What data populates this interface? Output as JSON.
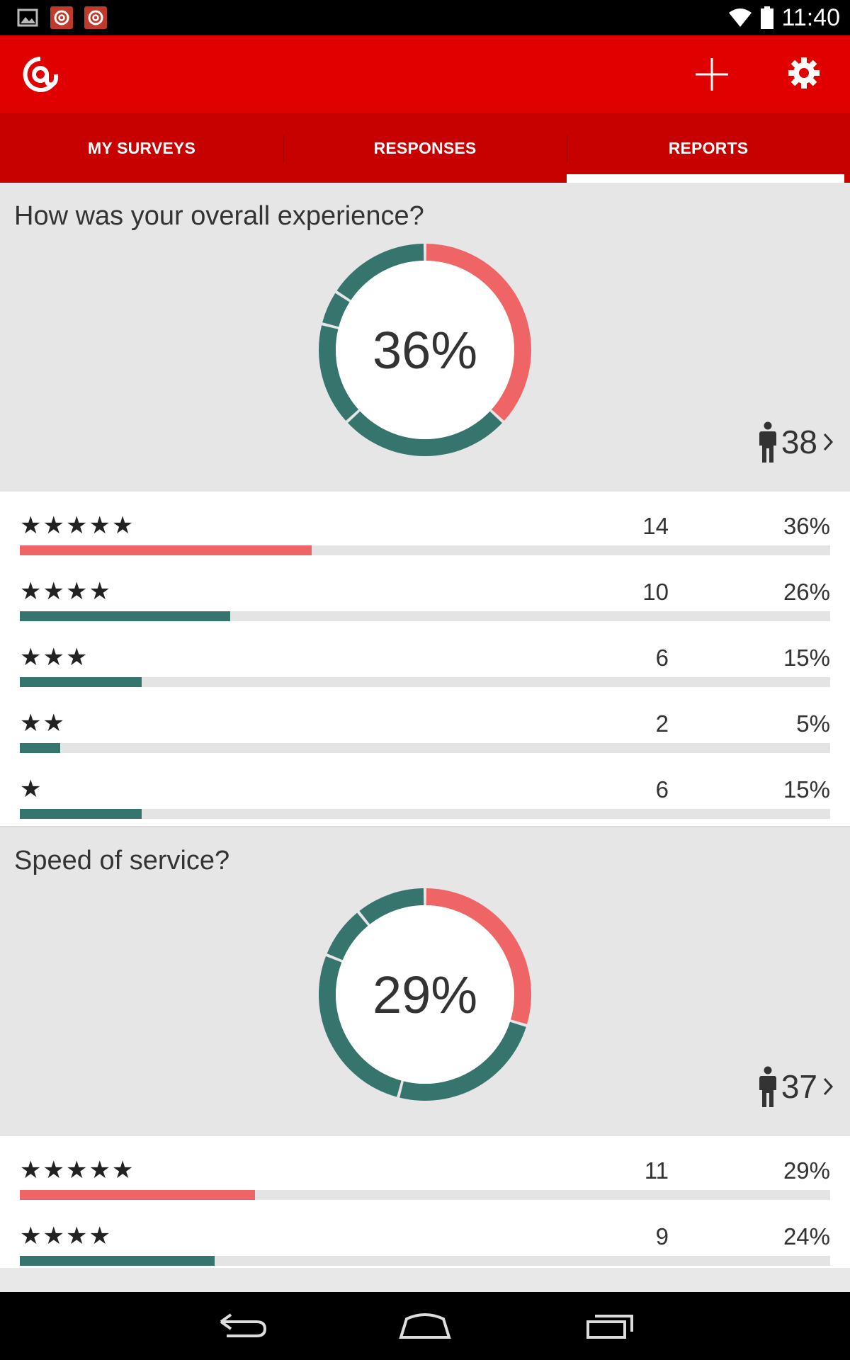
{
  "status_bar": {
    "time": "11:40",
    "icons": [
      "image-icon",
      "app-notification-icon",
      "app-notification-icon",
      "wifi-icon",
      "battery-icon"
    ]
  },
  "app_bar": {
    "logo_icon": "at-logo-icon",
    "actions": [
      "add-icon",
      "gear-icon"
    ]
  },
  "tabs": [
    {
      "label": "MY SURVEYS",
      "active": false
    },
    {
      "label": "RESPONSES",
      "active": false
    },
    {
      "label": "REPORTS",
      "active": true
    }
  ],
  "colors": {
    "brand_red": "#e10000",
    "tab_red": "#c70000",
    "top_rating": "#ef6464",
    "other_rating": "#35756e"
  },
  "questions": [
    {
      "title": "How was your overall experience?",
      "percent_label": "36%",
      "respondents": "38",
      "chart_data": {
        "type": "pie",
        "categories": [
          "5 stars",
          "4 stars",
          "3 stars",
          "2 stars",
          "1 star"
        ],
        "values": [
          14,
          10,
          6,
          2,
          6
        ]
      },
      "ratings": [
        {
          "stars": "★★★★★",
          "count": "14",
          "percent": "36%",
          "fraction": 0.36
        },
        {
          "stars": "★★★★",
          "count": "10",
          "percent": "26%",
          "fraction": 0.26
        },
        {
          "stars": "★★★",
          "count": "6",
          "percent": "15%",
          "fraction": 0.15
        },
        {
          "stars": "★★",
          "count": "2",
          "percent": "5%",
          "fraction": 0.05
        },
        {
          "stars": "★",
          "count": "6",
          "percent": "15%",
          "fraction": 0.15
        }
      ]
    },
    {
      "title": "Speed of service?",
      "percent_label": "29%",
      "respondents": "37",
      "chart_data": {
        "type": "pie",
        "categories": [
          "5 stars",
          "4 stars",
          "3 stars",
          "2 stars",
          "1 star"
        ],
        "values": [
          11,
          9,
          10,
          3,
          4
        ]
      },
      "ratings": [
        {
          "stars": "★★★★★",
          "count": "11",
          "percent": "29%",
          "fraction": 0.29
        },
        {
          "stars": "★★★★",
          "count": "9",
          "percent": "24%",
          "fraction": 0.24
        }
      ]
    }
  ],
  "nav_bar": [
    "back-icon",
    "home-icon",
    "recents-icon"
  ]
}
